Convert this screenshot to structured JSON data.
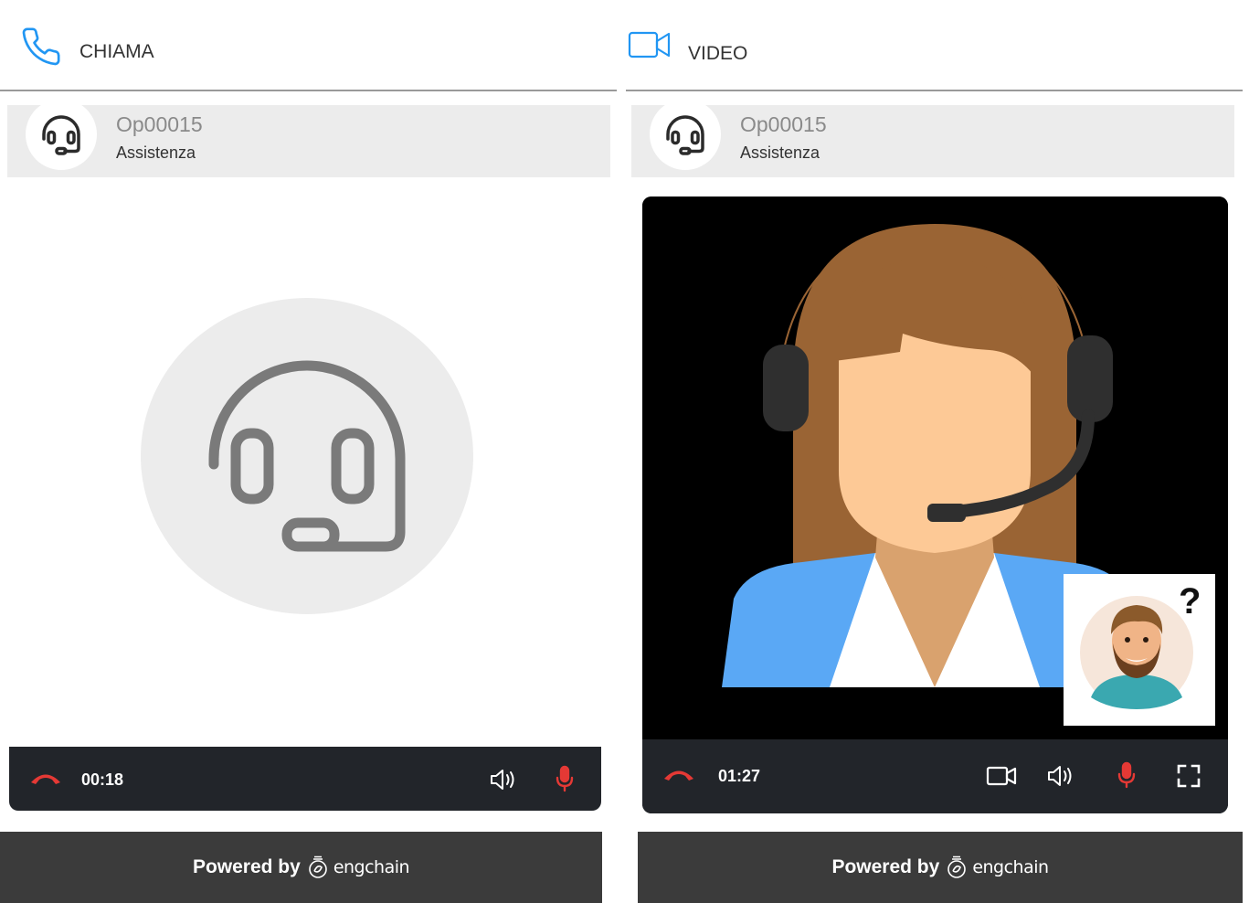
{
  "call_panel": {
    "tab_label": "CHIAMA",
    "operator": {
      "name": "Op00015",
      "department": "Assistenza"
    },
    "timer": "00:18",
    "colors": {
      "tab_icon": "#2196f3",
      "hangup": "#e53935",
      "mic": "#e53935"
    }
  },
  "video_panel": {
    "tab_label": "VIDEO",
    "operator": {
      "name": "Op00015",
      "department": "Assistenza"
    },
    "timer": "01:27",
    "pip_badge": "?",
    "colors": {
      "tab_icon": "#2196f3",
      "hangup": "#e53935",
      "mic": "#e53935"
    }
  },
  "footer": {
    "powered_by": "Powered by",
    "brand": "engchain"
  },
  "icons": [
    "phone-icon",
    "video-camera-icon",
    "headset-icon",
    "hangup-icon",
    "speaker-icon",
    "microphone-icon",
    "fullscreen-icon",
    "engchain-logo-icon"
  ]
}
